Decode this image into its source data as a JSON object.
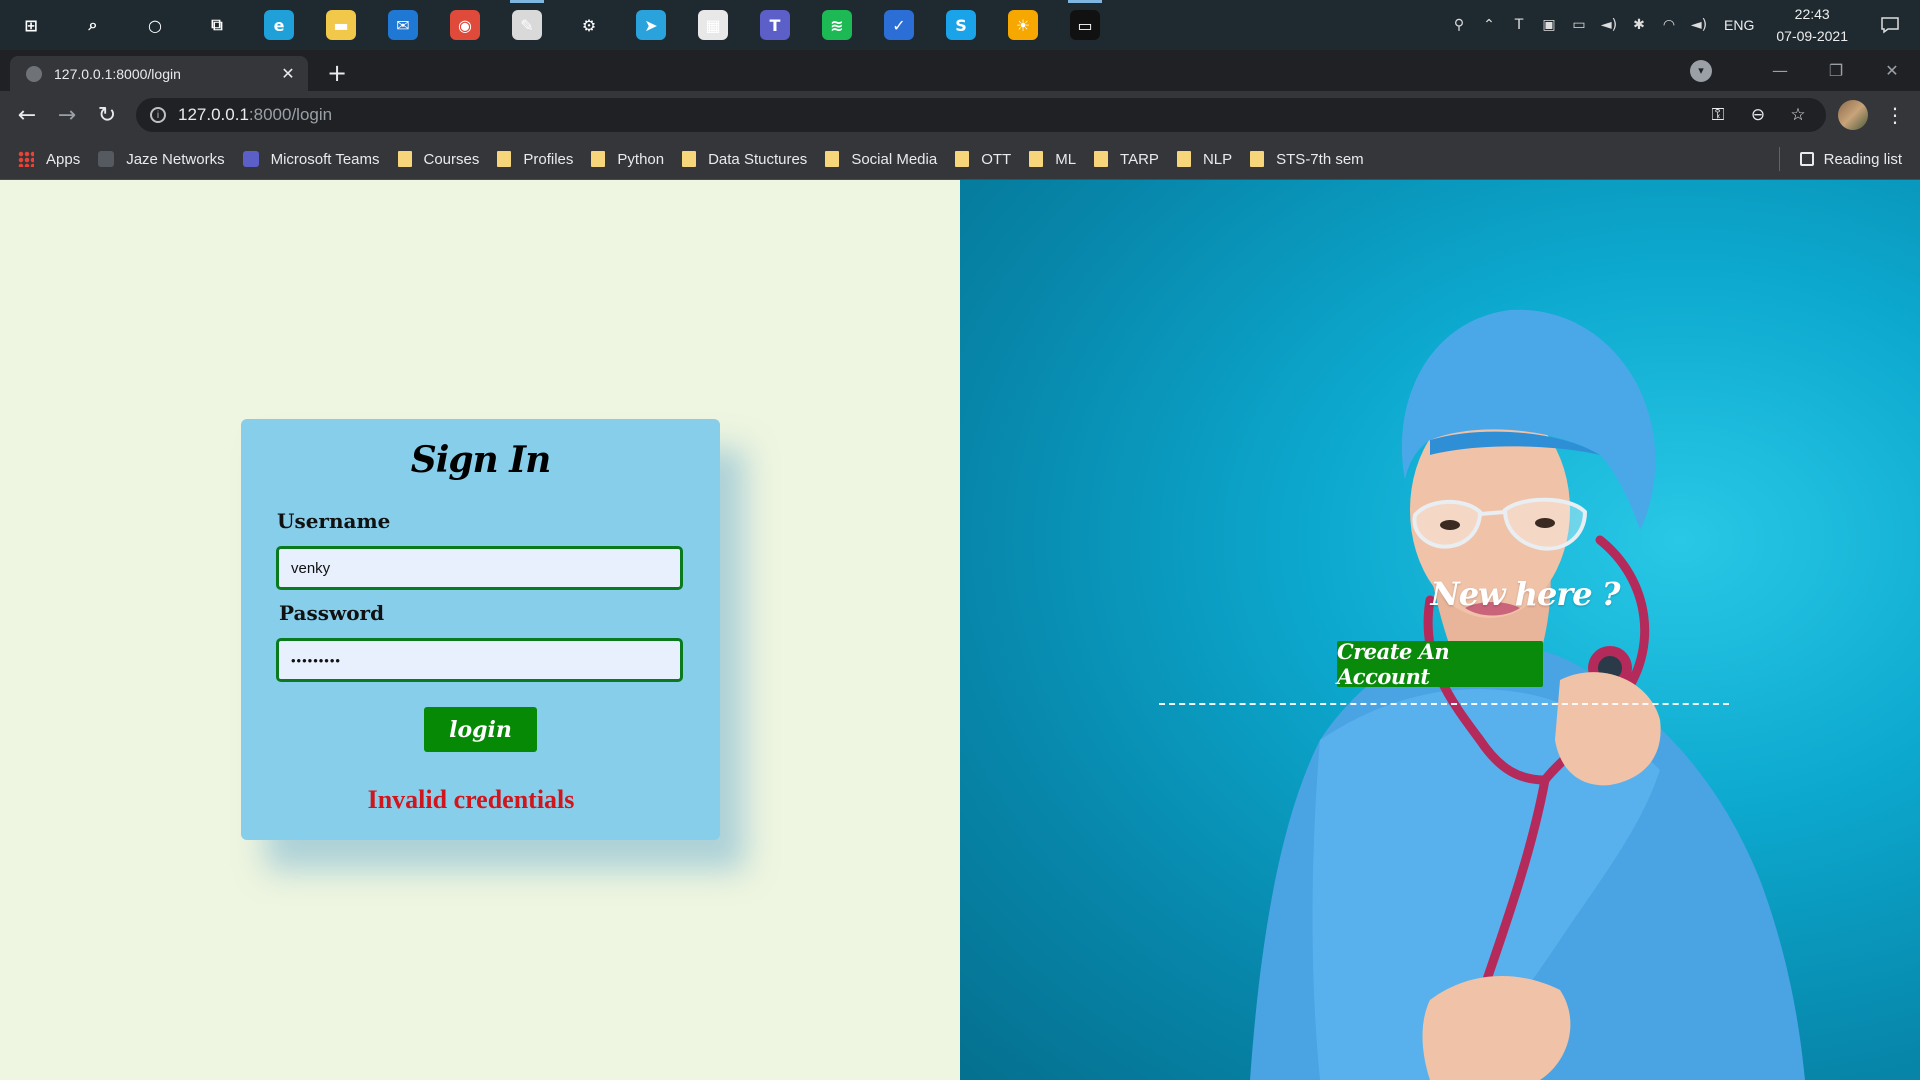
{
  "taskbar": {
    "apps": [
      {
        "name": "windows-start-icon",
        "glyph": "⊞",
        "color": "transparent"
      },
      {
        "name": "search-icon",
        "glyph": "⌕",
        "color": "transparent"
      },
      {
        "name": "cortana-icon",
        "glyph": "○",
        "color": "transparent"
      },
      {
        "name": "task-view-icon",
        "glyph": "⧉",
        "color": "transparent"
      },
      {
        "name": "edge-icon",
        "glyph": "e",
        "color": "#1fa0d8"
      },
      {
        "name": "file-explorer-icon",
        "glyph": "▬",
        "color": "#f2c84b"
      },
      {
        "name": "mail-icon",
        "glyph": "✉",
        "color": "#1e78d4"
      },
      {
        "name": "chrome-icon",
        "glyph": "◉",
        "color": "#e04a3a"
      },
      {
        "name": "paint-icon",
        "glyph": "✎",
        "color": "#d9d9d9"
      },
      {
        "name": "settings-icon",
        "glyph": "⚙",
        "color": "transparent"
      },
      {
        "name": "telegram-icon",
        "glyph": "➤",
        "color": "#2aa3dc"
      },
      {
        "name": "store-icon",
        "glyph": "▦",
        "color": "#e8e8e8"
      },
      {
        "name": "teams-icon",
        "glyph": "T",
        "color": "#5b5fc7"
      },
      {
        "name": "spotify-icon",
        "glyph": "≋",
        "color": "#1db954"
      },
      {
        "name": "todo-icon",
        "glyph": "✓",
        "color": "#2b6fd6"
      },
      {
        "name": "skype-icon",
        "glyph": "S",
        "color": "#1aa3e8"
      },
      {
        "name": "weather-icon",
        "glyph": "☀",
        "color": "#f7a800"
      },
      {
        "name": "terminal-icon",
        "glyph": "▭",
        "color": "#111111"
      }
    ],
    "tray": [
      "⚲",
      "⌃",
      "T",
      "▣",
      "▭",
      "◄)",
      "✱",
      "◠",
      "◄)"
    ],
    "language": "ENG",
    "time": "22:43",
    "date": "07-09-2021"
  },
  "browser": {
    "tab_title": "127.0.0.1:8000/login",
    "url_host": "127.0.0.1",
    "url_path": ":8000/login",
    "bookmarks": [
      {
        "label": "Apps",
        "type": "apps"
      },
      {
        "label": "Jaze Networks",
        "type": "site",
        "color": "#555a60"
      },
      {
        "label": "Microsoft Teams",
        "type": "site",
        "color": "#5b5fc7"
      },
      {
        "label": "Courses",
        "type": "folder"
      },
      {
        "label": "Profiles",
        "type": "folder"
      },
      {
        "label": "Python",
        "type": "folder"
      },
      {
        "label": "Data Stuctures",
        "type": "folder"
      },
      {
        "label": "Social Media",
        "type": "folder"
      },
      {
        "label": "OTT",
        "type": "folder"
      },
      {
        "label": "ML",
        "type": "folder"
      },
      {
        "label": "TARP",
        "type": "folder"
      },
      {
        "label": "NLP",
        "type": "folder"
      },
      {
        "label": "STS-7th sem",
        "type": "folder"
      }
    ],
    "reading_list": "Reading list"
  },
  "login": {
    "title": "Sign In",
    "username_label": "Username",
    "username_value": "venky",
    "password_label": "Password",
    "password_value": "•••••••••",
    "login_button": "login",
    "error": "Invalid credentials"
  },
  "signup": {
    "prompt": "New here ?",
    "create_button": "Create An Account"
  },
  "colors": {
    "left_bg": "#eef5e0",
    "card_bg": "#87ceeb",
    "button_green": "#068a06",
    "error_red": "#d0161c",
    "right_bg": "#0da9cf"
  }
}
